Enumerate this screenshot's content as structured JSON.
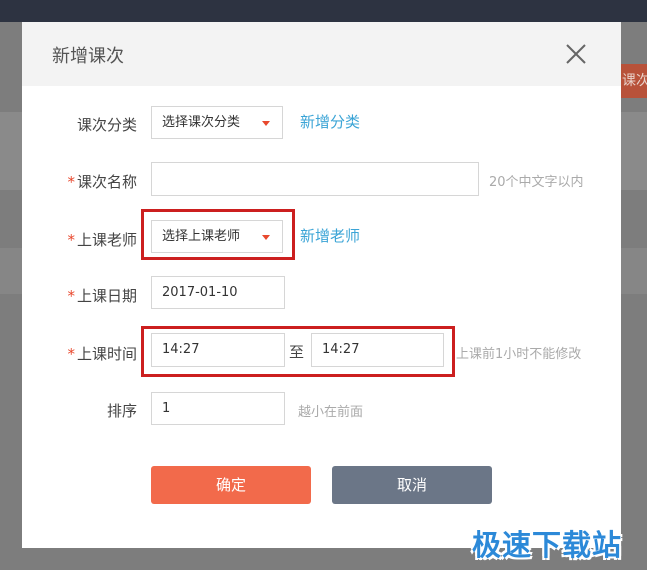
{
  "background": {
    "partial_button_text": "课次"
  },
  "dialog": {
    "title": "新增课次",
    "fields": {
      "category": {
        "label": "课次分类",
        "value": "选择课次分类",
        "link": "新增分类"
      },
      "name": {
        "label": "课次名称",
        "value": "",
        "hint": "20个中文字以内"
      },
      "teacher": {
        "label": "上课老师",
        "value": "选择上课老师",
        "link": "新增老师"
      },
      "date": {
        "label": "上课日期",
        "value": "2017-01-10"
      },
      "time": {
        "label": "上课时间",
        "start": "14:27",
        "separator": "至",
        "end": "14:27",
        "hint": "上课前1小时不能修改"
      },
      "order": {
        "label": "排序",
        "value": "1",
        "hint": "越小在前面"
      }
    },
    "buttons": {
      "confirm": "确定",
      "cancel": "取消"
    }
  },
  "required_mark": "*",
  "watermark": "极速下载站",
  "colors": {
    "confirm": "#f26a4b",
    "cancel": "#6b7687",
    "link": "#3ba4d6",
    "required": "#e8482e",
    "highlight": "#cc1f1f"
  }
}
